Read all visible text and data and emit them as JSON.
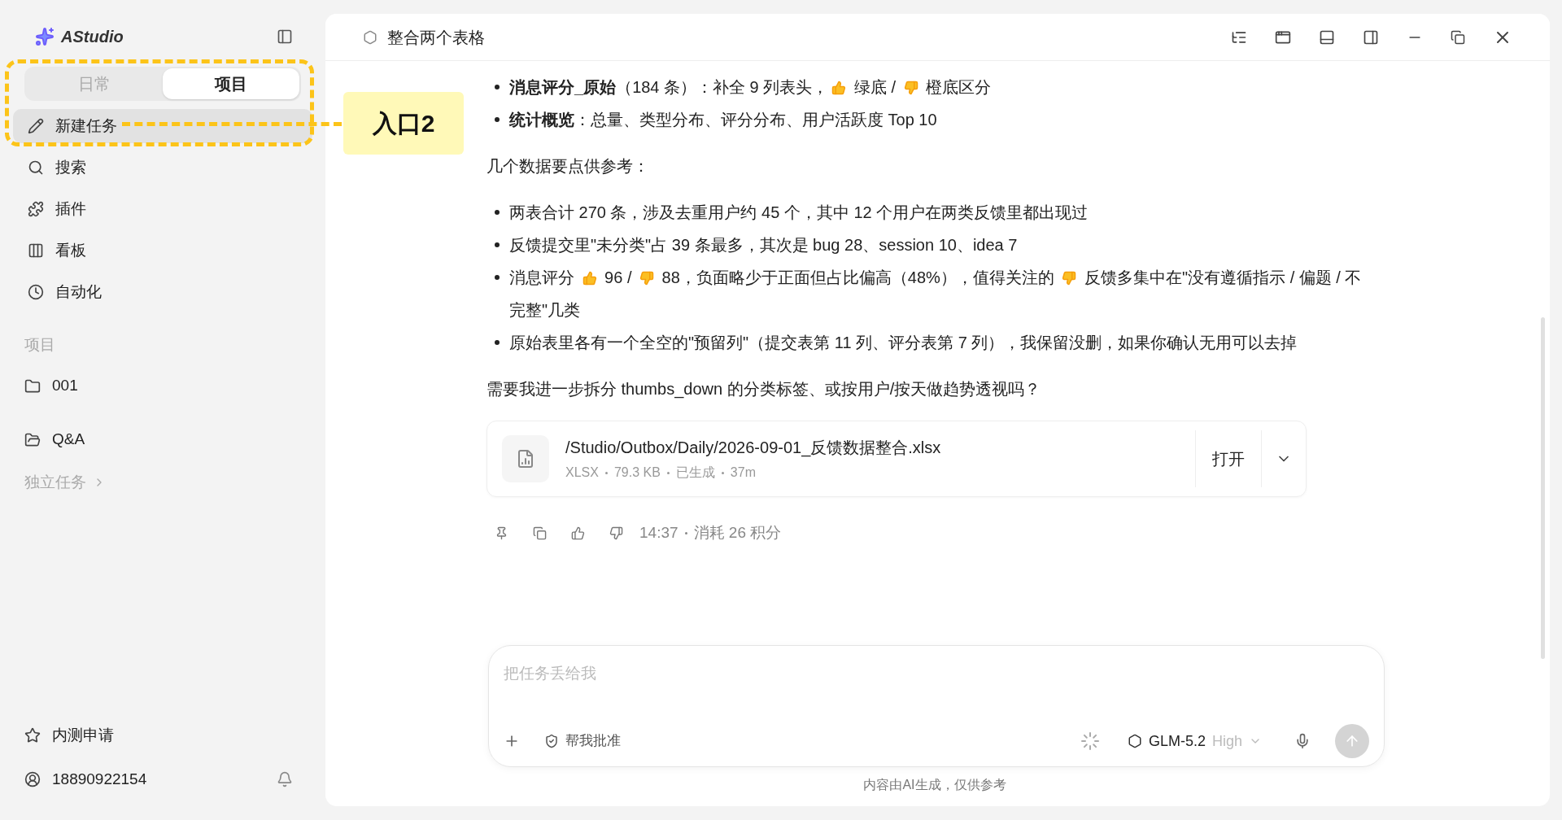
{
  "sidebar": {
    "app_name": "AStudio",
    "mode_tabs": [
      {
        "label": "日常",
        "selected": false
      },
      {
        "label": "项目",
        "selected": true
      }
    ],
    "nav_items": [
      {
        "label": "新建任务",
        "kind": "pencil",
        "selected": true
      },
      {
        "label": "搜索",
        "kind": "search",
        "selected": false
      },
      {
        "label": "插件",
        "kind": "plugin",
        "selected": false
      },
      {
        "label": "看板",
        "kind": "board",
        "selected": false
      },
      {
        "label": "自动化",
        "kind": "clock",
        "selected": false
      }
    ],
    "projects_heading": "项目",
    "projects": [
      {
        "label": "001",
        "kind": "folder"
      },
      {
        "label": "Q&A",
        "kind": "folder-open"
      }
    ],
    "standalone_tasks": "独立任务",
    "beta_apply": "内测申请",
    "account": "18890922154"
  },
  "annotation": {
    "label": "入口2"
  },
  "header": {
    "title": "整合两个表格"
  },
  "message": {
    "top_bullets": [
      [
        {
          "kind": "text",
          "text": "**消息评分_原始**（184 条）：补全 9 列表头，"
        },
        {
          "kind": "thumbs-up"
        },
        {
          "kind": "text",
          "text": " 绿底 / "
        },
        {
          "kind": "thumbs-down"
        },
        {
          "kind": "text",
          "text": " 橙底区分"
        }
      ],
      [
        {
          "kind": "text",
          "text": "**统计概览**：总量、类型分布、评分分布、用户活跃度 Top 10"
        }
      ]
    ],
    "intro": "几个数据要点供参考：",
    "points": [
      [
        {
          "kind": "text",
          "text": "两表合计 270 条，涉及去重用户约 45 个，其中 12 个用户在两类反馈里都出现过"
        }
      ],
      [
        {
          "kind": "text",
          "text": "反馈提交里\"未分类\"占 39 条最多，其次是 bug 28、session 10、idea 7"
        }
      ],
      [
        {
          "kind": "text",
          "text": "消息评分 "
        },
        {
          "kind": "thumbs-up"
        },
        {
          "kind": "text",
          "text": " 96 / "
        },
        {
          "kind": "thumbs-down"
        },
        {
          "kind": "text",
          "text": " 88，负面略少于正面但占比偏高（48%），值得关注的 "
        },
        {
          "kind": "thumbs-down"
        },
        {
          "kind": "text",
          "text": " 反馈多集中在\"没有遵循指示 / 偏题 / 不完整\"几类"
        }
      ],
      [
        {
          "kind": "text",
          "text": "原始表里各有一个全空的\"预留列\"（提交表第 11 列、评分表第 7 列），我保留没删，如果你确认无用可以去掉"
        }
      ]
    ],
    "question": "需要我进一步拆分 thumbs_down 的分类标签、或按用户/按天做趋势透视吗？",
    "file": {
      "path": "/Studio/Outbox/Daily/2026-09-01_反馈数据整合.xlsx",
      "meta": [
        "XLSX",
        "79.3 KB",
        "已生成",
        "37m"
      ],
      "open_label": "打开"
    },
    "time": "14:37",
    "cost": "消耗 26 积分"
  },
  "composer": {
    "placeholder": "把任务丢给我",
    "approve_label": "帮我批准",
    "model": "GLM-5.2",
    "effort": "High"
  },
  "disclaimer": "内容由AI生成，仅供参考"
}
